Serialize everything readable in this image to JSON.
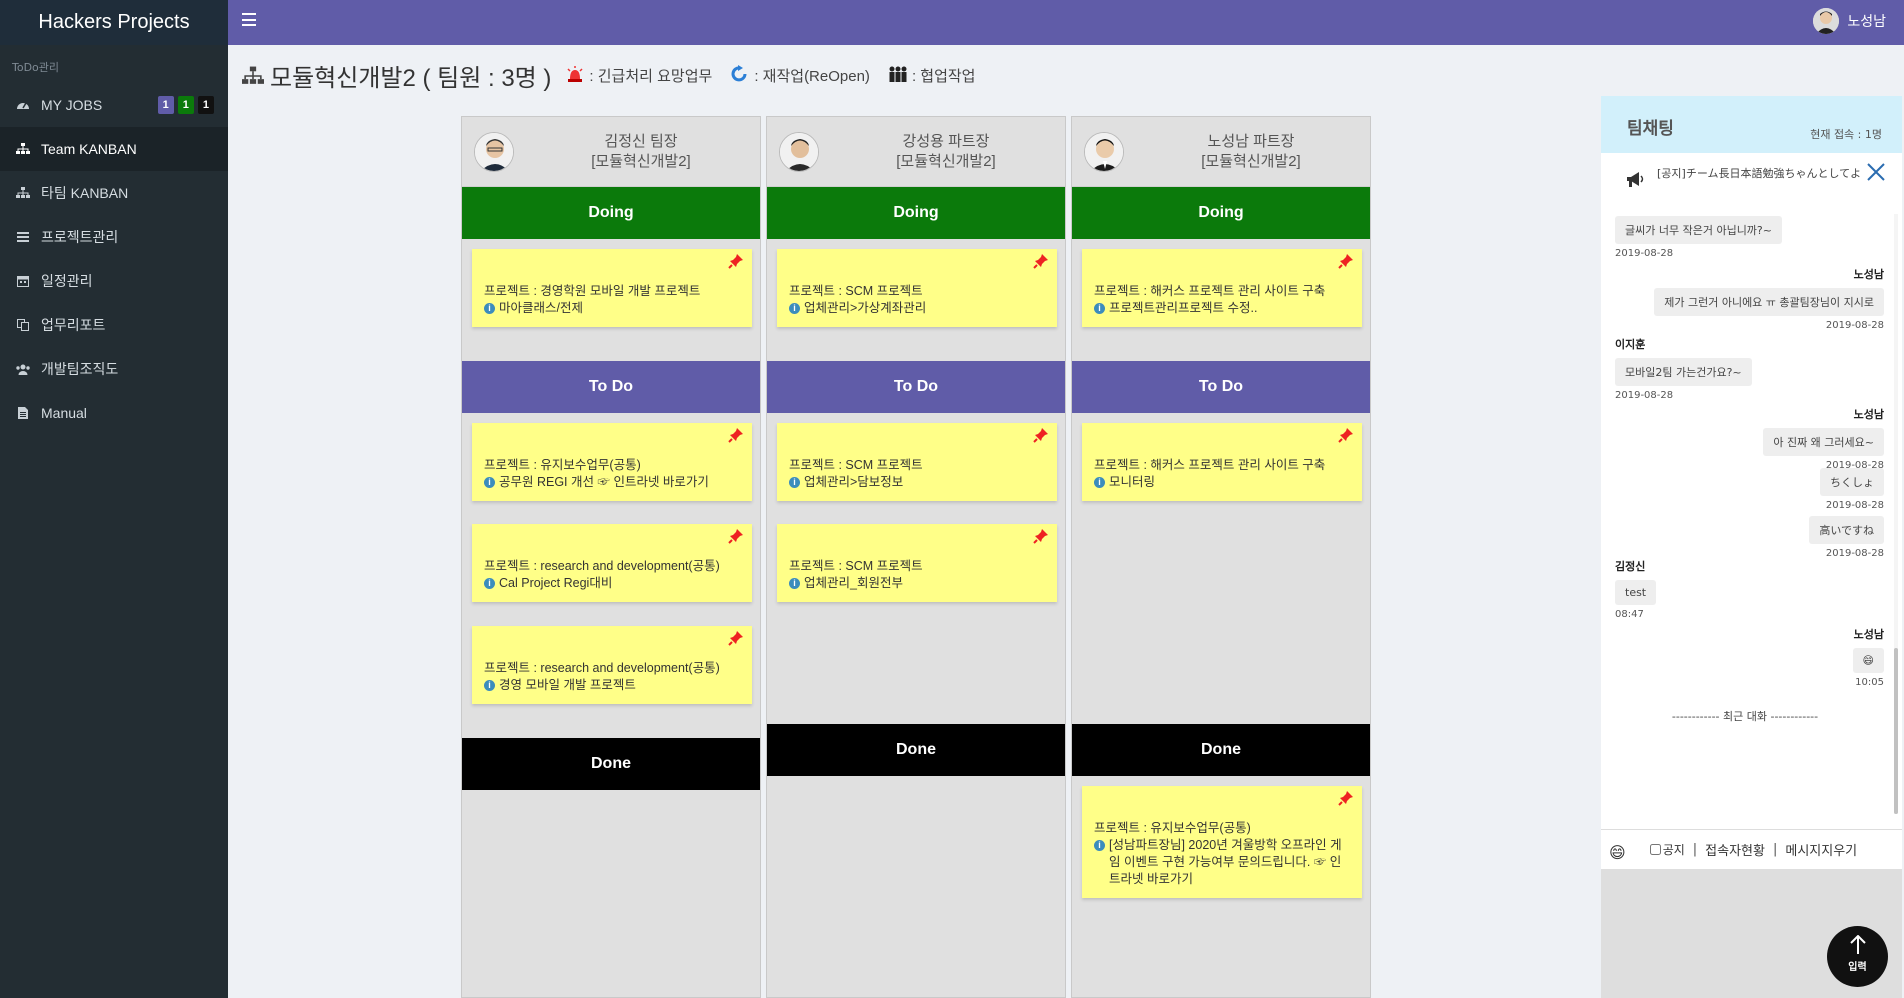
{
  "app": {
    "brand": "Hackers Projects"
  },
  "sidebar": {
    "section": "ToDo관리",
    "items": [
      {
        "label": "MY JOBS",
        "icon": "dashboard-icon",
        "badges": [
          "1",
          "1",
          "1"
        ]
      },
      {
        "label": "Team KANBAN",
        "icon": "sitemap-icon"
      },
      {
        "label": "타팀 KANBAN",
        "icon": "sitemap-icon"
      },
      {
        "label": "프로젝트관리",
        "icon": "list-icon"
      },
      {
        "label": "일정관리",
        "icon": "calendar-icon"
      },
      {
        "label": "업무리포트",
        "icon": "copy-icon"
      },
      {
        "label": "개발팀조직도",
        "icon": "users-icon"
      },
      {
        "label": "Manual",
        "icon": "file-icon"
      }
    ]
  },
  "topbar": {
    "user_name": "노성남"
  },
  "page": {
    "title": "모듈혁신개발2 ( 팀원 : 3명 )",
    "legend": [
      {
        "label": ": 긴급처리 요망업무",
        "icon": "siren-icon"
      },
      {
        "label": ": 재작업(ReOpen)",
        "icon": "reopen-icon"
      },
      {
        "label": ": 협업작업",
        "icon": "cooperation-icon"
      }
    ]
  },
  "lanes": {
    "doing": "Doing",
    "todo": "To Do",
    "done": "Done"
  },
  "columns": [
    {
      "name": "김정신 팀장",
      "team": "[모듈혁신개발2]",
      "doing": [
        {
          "project": "프로젝트 : 경영학원 모바일 개발 프로젝트",
          "task": "마아클래스/전제"
        }
      ],
      "todo": [
        {
          "project": "프로젝트 : 유지보수업무(공통)",
          "task": "공무원 REGI 개선 ☞ 인트라넷 바로가기"
        },
        {
          "project": "프로젝트 : research and development(공통)",
          "task": "Cal Project Regi대비"
        },
        {
          "project": "프로젝트 : research and development(공통)",
          "task": "경영 모바일 개발 프로젝트"
        }
      ],
      "done": []
    },
    {
      "name": "강성용 파트장",
      "team": "[모듈혁신개발2]",
      "doing": [
        {
          "project": "프로젝트 : SCM 프로젝트",
          "task": "업체관리>가상계좌관리"
        }
      ],
      "todo": [
        {
          "project": "프로젝트 : SCM 프로젝트",
          "task": "업체관리>담보정보"
        },
        {
          "project": "프로젝트 : SCM 프로젝트",
          "task": "업체관리_회원전부"
        }
      ],
      "done": []
    },
    {
      "name": "노성남 파트장",
      "team": "[모듈혁신개발2]",
      "doing": [
        {
          "project": "프로젝트 : 해커스 프로젝트 관리 사이트 구축",
          "task": "프로젝트관리프로젝트 수정.."
        }
      ],
      "todo": [
        {
          "project": "프로젝트 : 해커스 프로젝트 관리 사이트 구축",
          "task": "모니터링"
        }
      ],
      "done": [
        {
          "project": "프로젝트 : 유지보수업무(공통)",
          "task": "[성남파트장님] 2020년 겨울방학 오프라인 게임 이벤트 구현 가능여부 문의드립니다. ☞ 인트라넷 바로가기"
        }
      ]
    }
  ],
  "chat": {
    "title": "팀채팅",
    "status": "현재 접속 : 1명",
    "notice": "[공지]チーム長日本語勉強ちゃんとしてよ",
    "messages": [
      {
        "side": "left",
        "name": "",
        "text": "글씨가 너무 작은거 아닙니까?~",
        "date": "2019-08-28"
      },
      {
        "side": "right",
        "name": "노성남",
        "text": "제가 그런거 아니에요 ㅠ 총괄팀장님이 지시로",
        "date": "2019-08-28"
      },
      {
        "side": "left",
        "name": "이지훈",
        "text": "모바일2팀 가는건가요?~",
        "date": "2019-08-28"
      },
      {
        "side": "right",
        "name": "노성남",
        "text": "아 진짜 왜 그러세요~",
        "date": "2019-08-28"
      },
      {
        "side": "right",
        "name": "",
        "text": "ちくしょ",
        "date": "2019-08-28"
      },
      {
        "side": "right",
        "name": "",
        "text": "高いですね",
        "date": "2019-08-28"
      },
      {
        "side": "left",
        "name": "김정신",
        "text": "test",
        "date": "08:47"
      },
      {
        "side": "right",
        "name": "노성남",
        "text": "😄",
        "date": "10:05"
      }
    ],
    "divider": "------------ 최근 대화 ------------",
    "toolbar": {
      "notice_label": "공지",
      "status_label": "접속자현황",
      "clear_label": "메시지지우기"
    },
    "send_label": "입력"
  }
}
